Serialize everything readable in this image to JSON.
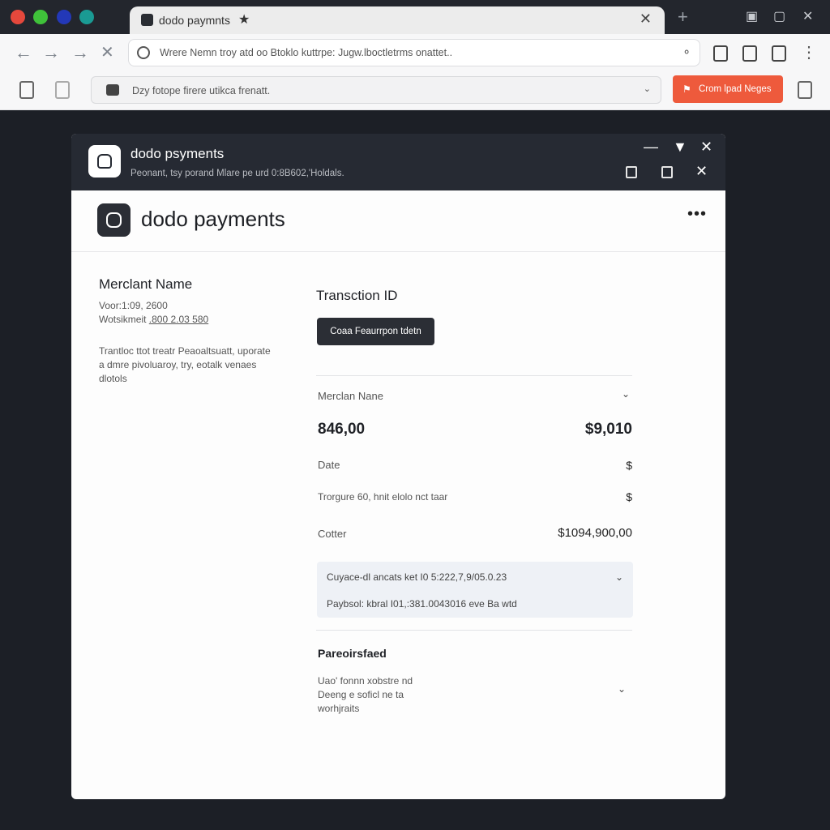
{
  "browser": {
    "tab_title": "dodo paymnts",
    "url": "Wrere Nemn troy atd oo Btoklo kuttrpe: Jugw.lboctletrms onattet..",
    "ext_search": "Dzy fotope firere utikca frenatt.",
    "ext_button_label": "Crom lpad Neges",
    "colors": {
      "accent": "#ee5a3c",
      "chrome": "#23262d"
    },
    "icons": [
      "back-icon",
      "forward-icon",
      "reload-icon",
      "close-icon",
      "lock-icon",
      "share-icon",
      "new-tab-icon"
    ]
  },
  "window": {
    "title": "dodo psyments",
    "subtitle": "Peonant, tsy porand Mlare pe urd 0:8B602,'Holdals."
  },
  "brand": {
    "name": "dodo payments",
    "more": "•••"
  },
  "merchant": {
    "title": "Merclant Name",
    "meta1": "Voor:1:09, 2600",
    "meta2_label": "Wotsikmeit",
    "meta2_value": ".800 2.03 580",
    "desc": "Trantloc ttot treatr Peaoaltsuatt, uporate a dmre pivoluaroy, try, eotalk venaes dlotols"
  },
  "transaction": {
    "title": "Transction ID",
    "copy_button": "Coaa Feaurrpon tdetn",
    "merchant_row_label": "Merclan Nane",
    "amount_left": "846,00",
    "amount_right": "$9,010",
    "date_label": "Date",
    "date_value": "$",
    "tongue_label": "Trorgure 60, hnit elolo nct taar",
    "tongue_value": "$",
    "cotter_label": "Cotter",
    "cotter_value": "$1094,900,00",
    "info_line1": "Cuyace-dl ancats ket I0 5:222,7,9/05.0.23",
    "info_line2": "Paybsol: kbral I01,:381.0043016 eve Ba wtd",
    "section_title": "Pareoirsfaed",
    "section_lines": [
      "Uao' fonnn xobstre nd",
      "Deeng e soficl ne ta",
      "worhjraits"
    ]
  }
}
